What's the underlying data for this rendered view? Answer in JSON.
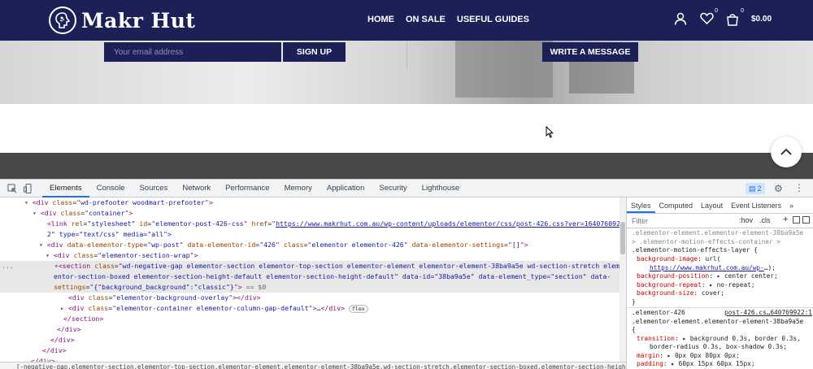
{
  "site": {
    "brand": "Makr Hut",
    "nav": [
      "HOME",
      "ON SALE",
      "USEFUL GUIDES"
    ],
    "wishlist_count": "0",
    "cart_count": "0",
    "cart_total": "$0.00",
    "email_placeholder": "Your email address",
    "signup_label": "SIGN UP",
    "write_message_label": "WRITE A MESSAGE"
  },
  "devtools": {
    "tabs": [
      "Elements",
      "Console",
      "Sources",
      "Network",
      "Performance",
      "Memory",
      "Application",
      "Security",
      "Lighthouse"
    ],
    "active_tab": "Elements",
    "issues_count": "2",
    "styles_tabs": [
      "Styles",
      "Computed",
      "Layout",
      "Event Listeners"
    ],
    "filter_placeholder": "Filter",
    "hov_label": ":hov",
    "cls_label": ".cls",
    "dom": {
      "l1_cls": "wd-prefooter woodmart-prefooter",
      "l2_cls": "container",
      "l3_id": "elementor-post-426-css",
      "l3_href": "https://www.makrhut.com.au/wp-content/uploads/elementor/css/post-426.css?ver=164076092",
      "l3b": "2\" type=\"text/css\" media=\"all\">",
      "l4_type": "wp-post",
      "l4_id": "426",
      "l4_cls": "elementor elementor-426",
      "l4_settings": "[]",
      "l5_cls": "elementor-section-wrap",
      "l6_cls": "wd-negative-gap elementor-section elementor-top-section elementor-element elementor-element-38ba9a5e wd-section-stretch elem",
      "l6b": "entor-section-boxed elementor-section-height-default elementor-section-height-default\" data-id=\"38ba9a5e\" data-element_type=\"section\" data-",
      "l6c_settings": "{\"background_background\":\"classic\"}",
      "l6c_tail": " == $0",
      "l7_cls": "elementor-background-overlay",
      "l8_cls": "elementor-container elementor-column-gap-default",
      "flex_badge": "flex",
      "breadcrumb": "[-negative-gap.elementor-section.elementor-top-section.elementor-element.elementor-element-38ba9a5e.wd-section-stretch.elementor-section-boxed.elementor-section-height-default"
    },
    "styles": {
      "r0a": ".elementor-element.elementor-element-38ba9a5e",
      "r0b": "> .elementor-motion-effects-container >",
      "r0c": ".elementor-motion-effects-layer {",
      "bg_image_prop": "background-image",
      "bg_image_val": "https://www.makrhut.com.au/wp-",
      "bg_pos_prop": "background-position",
      "bg_pos_val": "center center;",
      "bg_repeat_prop": "background-repeat",
      "bg_repeat_val": "no-repeat;",
      "bg_size_prop": "background-size",
      "bg_size_val": "cover;",
      "r1_sel": ".elementor-426",
      "r1_src": "post-426.cs…640769922:1",
      "r1b": ".elementor-element.elementor-element-38ba9a5e",
      "transition_prop": "transition",
      "transition_val": "background 0.3s, border 0.3s,",
      "transition_val2": "border-radius 0.3s, box-shadow 0.3s;",
      "margin_prop": "margin",
      "margin_val": "0px 0px 80px 0px;",
      "padding_prop": "padding",
      "padding_val": "60px 15px 60px 15px;"
    }
  }
}
